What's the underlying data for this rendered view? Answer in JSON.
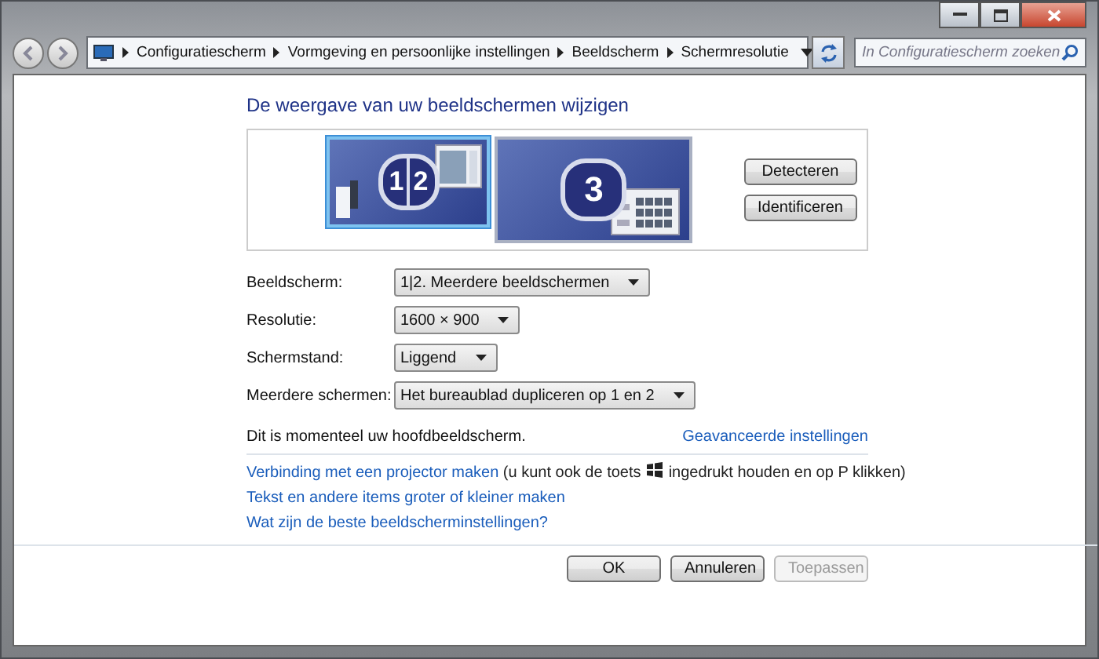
{
  "address_bar": {
    "breadcrumbs": [
      "Configuratiescherm",
      "Vormgeving en persoonlijke instellingen",
      "Beeldscherm",
      "Schermresolutie"
    ]
  },
  "search": {
    "placeholder": "In Configuratiescherm zoeken"
  },
  "heading": "De weergave van uw beeldschermen wijzigen",
  "monitors": [
    {
      "numbers": [
        "1",
        "2"
      ],
      "selected": true
    },
    {
      "numbers": [
        "3"
      ],
      "selected": false
    }
  ],
  "monitor_buttons": [
    "Detecteren",
    "Identificeren"
  ],
  "settings": [
    {
      "label": "Beeldscherm:",
      "value": "1|2. Meerdere beeldschermen"
    },
    {
      "label": "Resolutie:",
      "value": "1600 × 900"
    },
    {
      "label": "Schermstand:",
      "value": "Liggend"
    },
    {
      "label": "Meerdere schermen:",
      "value": "Het bureaublad dupliceren op 1 en 2"
    }
  ],
  "status": "Dit is momenteel uw hoofdbeeldscherm.",
  "advanced_link": "Geavanceerde instellingen",
  "projector": {
    "link": "Verbinding met een projector maken",
    "before_icon": "(u kunt ook de toets",
    "after_icon": "ingedrukt houden en op P klikken)"
  },
  "links": [
    "Tekst en andere items groter of kleiner maken",
    "Wat zijn de beste beeldscherminstellingen?"
  ],
  "buttons": [
    {
      "label": "OK",
      "disabled": false
    },
    {
      "label": "Annuleren",
      "disabled": false
    },
    {
      "label": "Toepassen",
      "disabled": true
    }
  ]
}
